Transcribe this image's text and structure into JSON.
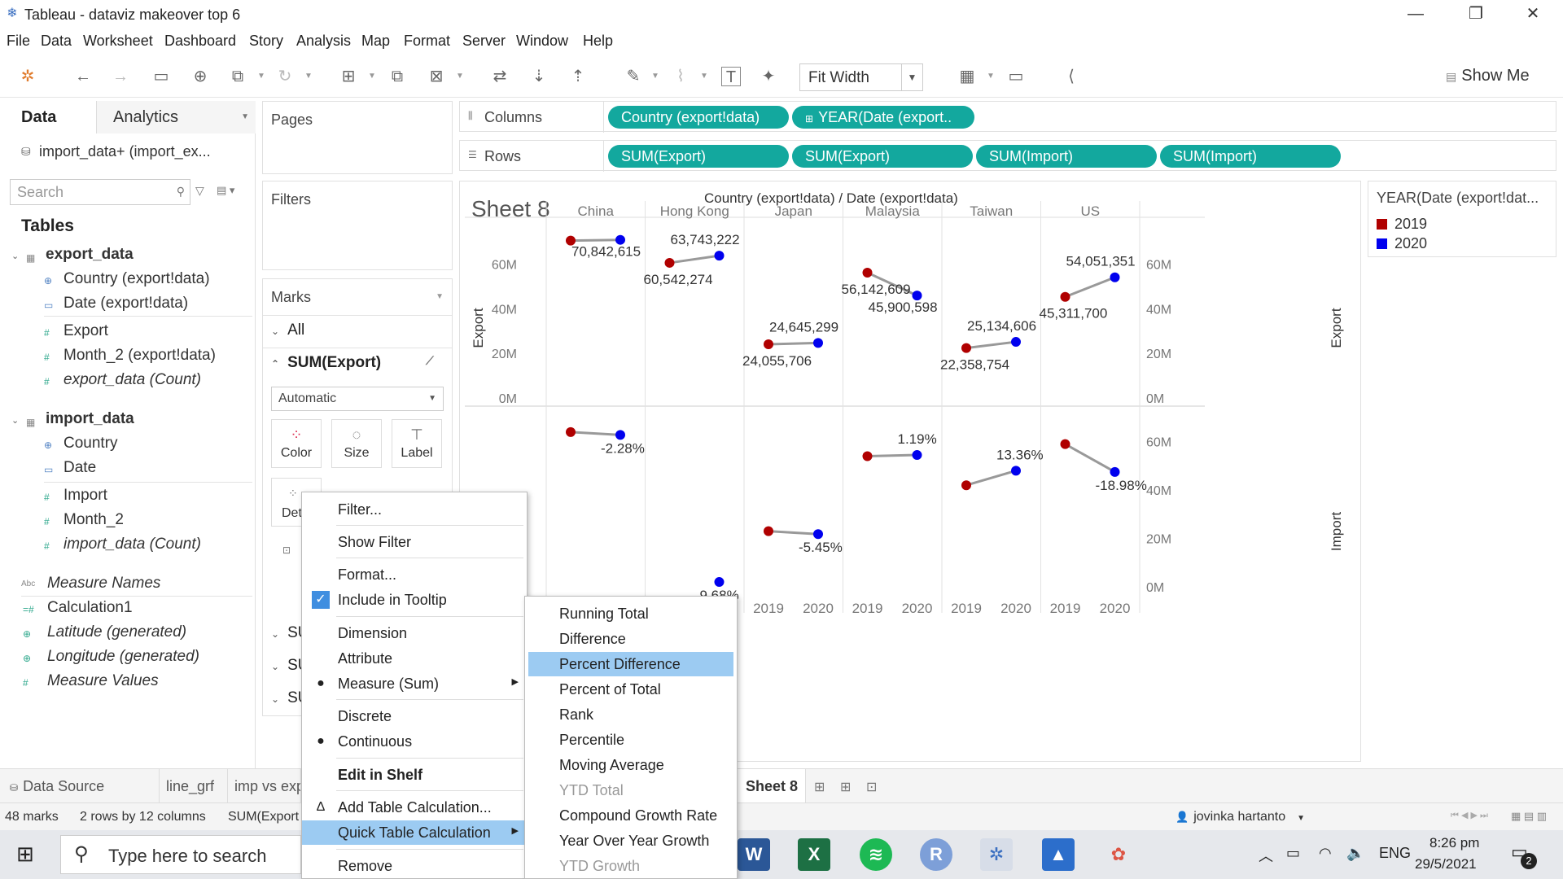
{
  "window": {
    "title": "Tableau - dataviz makeover top 6",
    "controls": {
      "minimize": "—",
      "restore": "❐",
      "close": "✕"
    }
  },
  "menu": [
    "File",
    "Data",
    "Worksheet",
    "Dashboard",
    "Story",
    "Analysis",
    "Map",
    "Format",
    "Server",
    "Window",
    "Help"
  ],
  "toolbar": {
    "fit": "Fit Width",
    "show_me": "Show Me"
  },
  "data_panel": {
    "tab_data": "Data",
    "tab_analytics": "Analytics",
    "datasource": "import_data+ (import_ex...",
    "search_placeholder": "Search",
    "tables_heading": "Tables",
    "table1": "export_data",
    "table1_fields": [
      "Country (export!data)",
      "Date (export!data)",
      "Export",
      "Month_2 (export!data)",
      "export_data (Count)"
    ],
    "table2": "import_data",
    "table2_fields": [
      "Country",
      "Date",
      "Import",
      "Month_2",
      "import_data (Count)"
    ],
    "extra_fields": [
      "Measure Names",
      "Calculation1",
      "Latitude (generated)",
      "Longitude (generated)",
      "Measure Values"
    ]
  },
  "cards": {
    "pages": "Pages",
    "filters": "Filters",
    "marks": "Marks",
    "all": "All",
    "sum_export": "SUM(Export)",
    "mark_type": "Automatic",
    "color": "Color",
    "size": "Size",
    "label": "Label",
    "detail": "Det",
    "sub_rows": [
      "SU",
      "SU",
      "SU"
    ]
  },
  "shelves": {
    "columns_label": "Columns",
    "rows_label": "Rows",
    "columns": [
      "Country (export!data)",
      "YEAR(Date (export.."
    ],
    "rows": [
      "SUM(Export)",
      "SUM(Export)",
      "SUM(Import)",
      "SUM(Import)"
    ]
  },
  "sheet": {
    "title": "Sheet 8",
    "header": "Country (export!data)  /  Date (export!data)"
  },
  "legend": {
    "title": "YEAR(Date (export!dat...",
    "items": [
      {
        "label": "2019",
        "color": "#b00000"
      },
      {
        "label": "2020",
        "color": "#0000ee"
      }
    ]
  },
  "chart_data": {
    "type": "line",
    "countries": [
      "China",
      "Hong Kong",
      "Japan",
      "Malaysia",
      "Taiwan",
      "US"
    ],
    "years": [
      "2019",
      "2020"
    ],
    "top": {
      "ylabel": "Export",
      "ylim": [
        0,
        70000000
      ],
      "ticks": [
        "0M",
        "20M",
        "40M",
        "60M"
      ],
      "values": [
        [
          70500000,
          70842615
        ],
        [
          60542274,
          63743222
        ],
        [
          24055706,
          24645299
        ],
        [
          56142609,
          45900598
        ],
        [
          22358754,
          25134606
        ],
        [
          45311700,
          54051351
        ]
      ],
      "labels": [
        "70,842,615",
        "60,542,274",
        "63,743,222",
        "24,055,706",
        "24,645,299",
        "56,142,609",
        "45,900,598",
        "22,358,754",
        "25,134,606",
        "45,311,700",
        "54,051,351"
      ]
    },
    "bottom": {
      "ylabel": "Import",
      "ylim": [
        0,
        70000000
      ],
      "right_ticks": [
        "0M",
        "20M",
        "40M",
        "60M"
      ],
      "values": [
        [
          64000000,
          62800000
        ],
        [
          null,
          2000000
        ],
        [
          23000000,
          21800000
        ],
        [
          54000000,
          54500000
        ],
        [
          42000000,
          48000000
        ],
        [
          59000000,
          47500000
        ]
      ],
      "pct_labels": [
        "-2.28%",
        "9.68%",
        "-5.45%",
        "1.19%",
        "13.36%",
        "-18.98%"
      ]
    },
    "visible_axis_years": [
      "2020",
      "2019",
      "2020",
      "2019",
      "2020",
      "2019",
      "2020",
      "2019",
      "2020"
    ],
    "colors": {
      "y2019": "#b00000",
      "y2020": "#0000ee",
      "line": "#999999"
    },
    "grid": true
  },
  "context_menu": {
    "items": [
      "Filter...",
      "Show Filter",
      "Format...",
      "Include in Tooltip",
      "Dimension",
      "Attribute",
      "Measure (Sum)",
      "Discrete",
      "Continuous",
      "Edit in Shelf",
      "Add Table Calculation...",
      "Quick Table Calculation",
      "Remove"
    ]
  },
  "quick_calc_menu": {
    "items": [
      "Running Total",
      "Difference",
      "Percent Difference",
      "Percent of Total",
      "Rank",
      "Percentile",
      "Moving Average",
      "YTD Total",
      "Compound Growth Rate",
      "Year Over Year Growth",
      "YTD Growth"
    ]
  },
  "sheet_tabs": [
    "Data Source",
    "line_grf",
    "imp vs exp",
    "Sheet 8"
  ],
  "status": {
    "marks": "48 marks",
    "dims": "2 rows by 12 columns",
    "sum": "SUM(Export",
    "user": "jovinka hartanto"
  },
  "taskbar": {
    "search_placeholder": "Type here to search",
    "lang": "ENG",
    "time": "8:26 pm",
    "date": "29/5/2021",
    "notif_count": "2"
  }
}
